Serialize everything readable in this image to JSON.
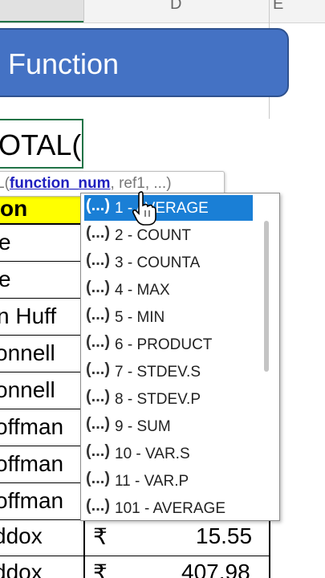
{
  "columns": {
    "d": "D",
    "e": "E"
  },
  "banner": {
    "title": "Function"
  },
  "formula": {
    "text": "OTAL("
  },
  "tooltip": {
    "prefix": "L(",
    "active_arg": "function_num",
    "rest": ", ref1, ...)"
  },
  "rows": [
    {
      "name": "on",
      "amount": ""
    },
    {
      "name": "e",
      "amount": ""
    },
    {
      "name": "e",
      "amount": ""
    },
    {
      "name": "n Huff",
      "amount": ""
    },
    {
      "name": "onnell",
      "amount": ""
    },
    {
      "name": "onnell",
      "amount": ""
    },
    {
      "name": "offman",
      "amount": ""
    },
    {
      "name": "offman",
      "amount": ""
    },
    {
      "name": "offman",
      "amount": ""
    },
    {
      "name": "ddox",
      "currency": "₹",
      "amount": "15.55"
    },
    {
      "name": "ddox",
      "currency": "₹",
      "amount": "407.98"
    }
  ],
  "dropdown": {
    "icon": "(...)",
    "items": [
      {
        "label": "1 - AVERAGE",
        "selected": true
      },
      {
        "label": "2 - COUNT"
      },
      {
        "label": "3 - COUNTA"
      },
      {
        "label": "4 - MAX"
      },
      {
        "label": "5 - MIN"
      },
      {
        "label": "6 - PRODUCT"
      },
      {
        "label": "7 - STDEV.S"
      },
      {
        "label": "8 - STDEV.P"
      },
      {
        "label": "9 - SUM"
      },
      {
        "label": "10 - VAR.S"
      },
      {
        "label": "11 - VAR.P"
      },
      {
        "label": "101 - AVERAGE"
      }
    ]
  },
  "colors": {
    "banner": "#4472c4",
    "highlight": "#ffff00",
    "selection": "#1a7fd6",
    "excel_green": "#217346"
  }
}
